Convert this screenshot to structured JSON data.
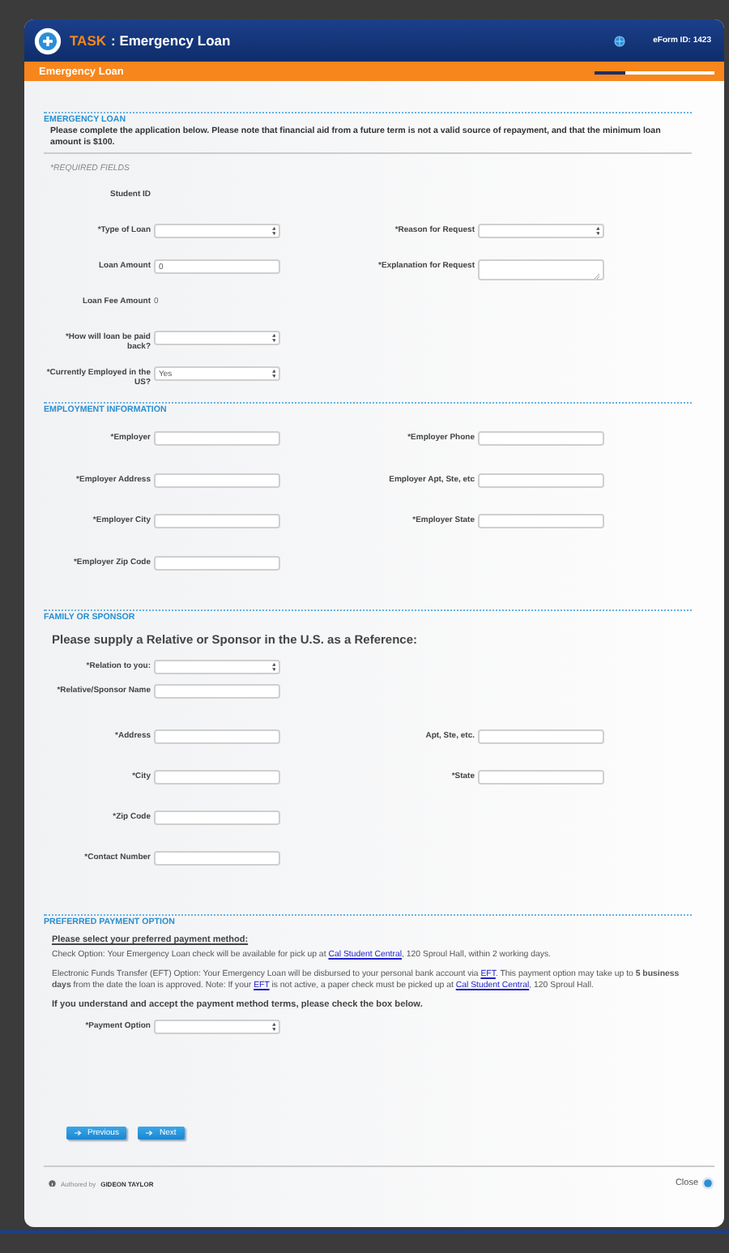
{
  "header": {
    "task_label": "TASK",
    "title": ": Emergency Loan",
    "form_id": "eForm ID: 1423"
  },
  "subheader": {
    "title": "Emergency Loan",
    "progress": {
      "level": 0.25
    }
  },
  "sections": [
    {
      "title": "EMERGENCY LOAN",
      "intro": "Please complete the application below.  Please note that financial aid from a future term is not a valid source of repayment, and that the minimum loan amount is $100.",
      "required_note": "*REQUIRED FIELDS",
      "rows": [
        {
          "left": {
            "label": "Student ID",
            "kind": "static"
          }
        },
        {
          "left": {
            "label": "*Type of Loan",
            "kind": "select"
          },
          "right": {
            "label": "*Reason for Request",
            "kind": "select"
          }
        },
        {
          "left": {
            "label": "Loan Amount",
            "kind": "text",
            "value": "0"
          },
          "right": {
            "label": "*Explanation for Request",
            "kind": "textarea"
          }
        },
        {
          "left": {
            "label": "Loan Fee Amount",
            "kind": "static",
            "value": "0"
          }
        },
        {
          "left": {
            "label": "*How will loan be paid back?",
            "kind": "select"
          }
        },
        {
          "left": {
            "label": "*Currently Employed in the US?",
            "kind": "select",
            "value": "Yes"
          }
        }
      ]
    },
    {
      "title": "EMPLOYMENT INFORMATION",
      "rows": [
        {
          "left": {
            "label": "*Employer",
            "kind": "text"
          },
          "right": {
            "label": "*Employer Phone",
            "kind": "text"
          }
        },
        {
          "left": {
            "label": "*Employer Address",
            "kind": "text"
          },
          "right": {
            "label": "Employer Apt, Ste, etc",
            "kind": "text"
          }
        },
        {
          "left": {
            "label": "*Employer City",
            "kind": "text"
          },
          "right": {
            "label": "*Employer State",
            "kind": "text"
          }
        },
        {
          "left": {
            "label": "*Employer Zip Code",
            "kind": "text"
          }
        }
      ]
    },
    {
      "title": "FAMILY OR SPONSOR",
      "heading": "Please supply a Relative or Sponsor in the U.S. as a Reference:",
      "rows": [
        {
          "left": {
            "label": "*Relation to you:",
            "kind": "select"
          }
        },
        {
          "left": {
            "label": "*Relative/Sponsor Name",
            "kind": "text"
          }
        },
        {
          "left": {
            "label": "*Address",
            "kind": "text"
          },
          "right": {
            "label": "Apt, Ste, etc.",
            "kind": "text"
          }
        },
        {
          "left": {
            "label": "*City",
            "kind": "text"
          },
          "right": {
            "label": "*State",
            "kind": "text"
          }
        },
        {
          "left": {
            "label": "*Zip Code",
            "kind": "text"
          }
        },
        {
          "left": {
            "label": "*Contact Number",
            "kind": "text"
          }
        }
      ]
    },
    {
      "title": "PREFERRED PAYMENT OPTION",
      "subtitle": "Please select your preferred payment method:",
      "paragraphs": [
        [
          {
            "text": "Check Option: Your Emergency Loan check will be available for pick up at "
          },
          {
            "link": "Cal Student Central"
          },
          {
            "text": ", 120 Sproul Hall, within 2 working days."
          }
        ],
        [
          {
            "text": "Electronic Funds Transfer (EFT) Option: Your Emergency Loan  will be disbursed to your personal bank account via "
          },
          {
            "link": "EFT"
          },
          {
            "text": ". This payment option may take up to **5 business days** from the date the loan is approved. Note: If your "
          },
          {
            "link": "EFT"
          },
          {
            "text": " is not active, a paper check must be picked up at "
          },
          {
            "link": "Cal Student Central"
          },
          {
            "text": ", 120 Sproul Hall."
          }
        ]
      ],
      "accept_note": "If you understand and accept the payment method terms, please check the box below.",
      "rows": [
        {
          "left": {
            "label": "*Payment Option",
            "kind": "select"
          }
        }
      ]
    }
  ],
  "buttons": [
    "Previous",
    "Next"
  ],
  "footer": {
    "authored_by": "Authored by",
    "vendor": "GIDEON TAYLOR",
    "close": "Close"
  }
}
